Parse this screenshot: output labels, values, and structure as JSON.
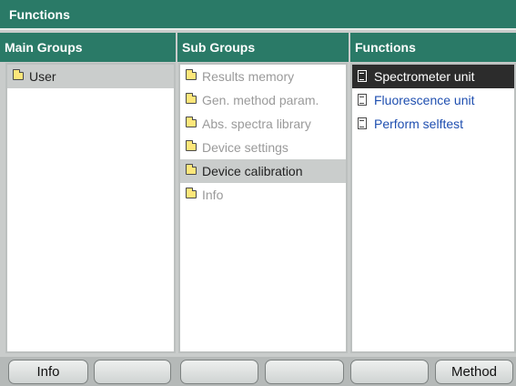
{
  "window": {
    "title": "Functions"
  },
  "columns": {
    "main_groups": {
      "header": "Main Groups",
      "items": [
        {
          "label": "User",
          "selected": true
        }
      ]
    },
    "sub_groups": {
      "header": "Sub Groups",
      "items": [
        {
          "label": "Results memory",
          "state": "disabled"
        },
        {
          "label": "Gen. method param.",
          "state": "disabled"
        },
        {
          "label": "Abs. spectra library",
          "state": "disabled"
        },
        {
          "label": "Device settings",
          "state": "disabled"
        },
        {
          "label": "Device calibration",
          "state": "selected"
        },
        {
          "label": "Info",
          "state": "disabled"
        }
      ]
    },
    "functions": {
      "header": "Functions",
      "items": [
        {
          "label": "Spectrometer unit",
          "state": "selected"
        },
        {
          "label": "Fluorescence unit",
          "state": "link"
        },
        {
          "label": "Perform selftest",
          "state": "link"
        }
      ]
    }
  },
  "softkeys": [
    "Info",
    "",
    "",
    "",
    "",
    "Method"
  ],
  "colors": {
    "header_bg": "#2a7a67",
    "link": "#1f4fb0",
    "disabled_text": "#9a9a9a"
  }
}
